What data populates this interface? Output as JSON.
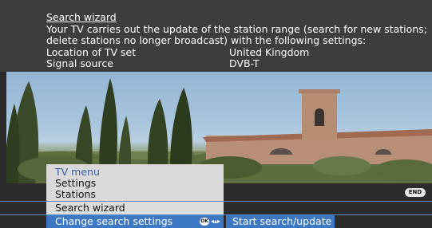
{
  "wizard": {
    "title": "Search wizard",
    "description_line1": "Your TV carries out the update of the station range (search for new stations;",
    "description_line2": "delete stations no longer broadcast) with the following settings:",
    "settings": [
      {
        "label": "Location of TV set",
        "value": "United Kingdom"
      },
      {
        "label": "Signal source",
        "value": "DVB-T"
      }
    ]
  },
  "menu": {
    "header": "TV menu",
    "items": [
      "Settings",
      "Stations",
      "Search wizard",
      "Change search settings"
    ],
    "selected": "Change search settings"
  },
  "actions": {
    "ok_label": "OK",
    "start_label": "Start search/update",
    "end_label": "END"
  },
  "colors": {
    "highlight": "#3c78c4",
    "header_text": "#3a5ea6",
    "info_bg": "#3d3d3d"
  }
}
